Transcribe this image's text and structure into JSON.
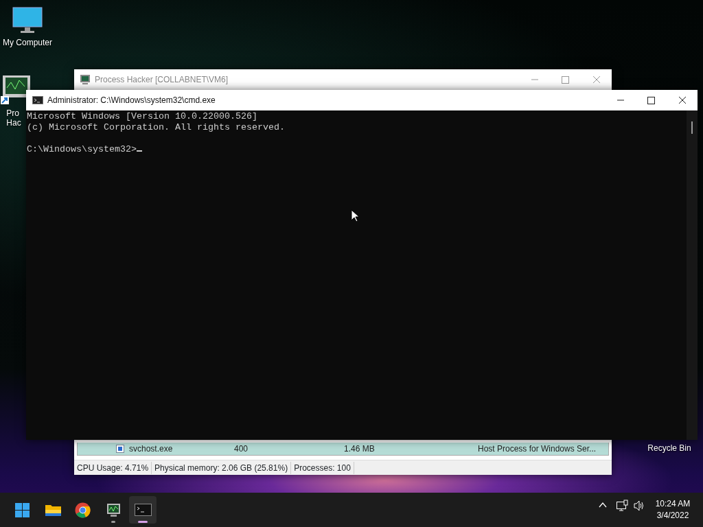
{
  "desktop_icons": [
    {
      "kind": "computer",
      "label_lines": [
        "My Computer"
      ]
    },
    {
      "kind": "app",
      "label_lines": [
        "Pro",
        "Hac"
      ]
    },
    {
      "kind": "recycle",
      "label_lines": [
        "Recycle Bin"
      ]
    }
  ],
  "process_hacker": {
    "title": "Process Hacker [COLLABNET\\VM6]",
    "rows": [
      {
        "name": "svchost.exe",
        "pid": "400",
        "memory": "1.46 MB",
        "description": "Host Process for Windows Ser...",
        "selected": true
      }
    ],
    "status_bar": [
      "CPU Usage: 4.71%",
      "Physical memory: 2.06 GB (25.81%)",
      "Processes: 100"
    ]
  },
  "cmd": {
    "title": "Administrator: C:\\Windows\\system32\\cmd.exe",
    "output": [
      "Microsoft Windows [Version 10.0.22000.526]",
      "(c) Microsoft Corporation. All rights reserved."
    ],
    "prompt": "C:\\Windows\\system32>"
  },
  "taskbar": {
    "apps": [
      {
        "kind": "start",
        "running": false,
        "selected": false
      },
      {
        "kind": "folder",
        "running": false,
        "selected": false
      },
      {
        "kind": "browser",
        "running": false,
        "selected": false
      },
      {
        "kind": "monitor",
        "running": true,
        "selected": false
      },
      {
        "kind": "terminal",
        "running": true,
        "selected": true
      }
    ],
    "time": "10:24 AM",
    "date": "3/4/2022"
  }
}
